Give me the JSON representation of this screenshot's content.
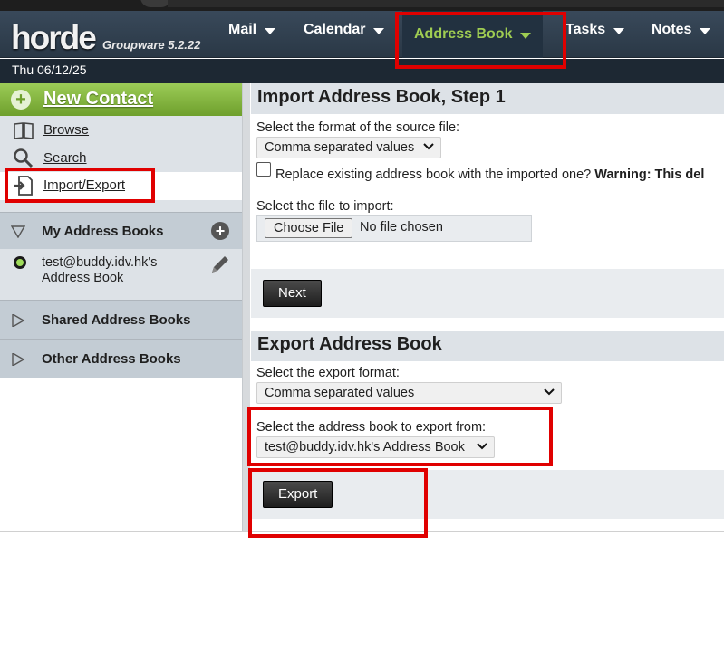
{
  "app": {
    "logo_text": "horde",
    "product": "Groupware 5.2.22",
    "date": "Thu 06/12/25"
  },
  "nav": {
    "mail": "Mail",
    "calendar": "Calendar",
    "address_book": "Address Book",
    "tasks": "Tasks",
    "notes": "Notes"
  },
  "sidebar": {
    "new_contact": "New Contact",
    "browse": "Browse",
    "search": "Search",
    "import_export": "Import/Export",
    "my_address_books": "My Address Books",
    "book_name_line1": "test@buddy.idv.hk's",
    "book_name_line2": "Address Book",
    "shared_address_books": "Shared Address Books",
    "other_address_books": "Other Address Books"
  },
  "import": {
    "title": "Import Address Book, Step 1",
    "format_label": "Select the format of the source file:",
    "format_value": "Comma separated values",
    "replace_label": "Replace existing address book with the imported one?",
    "warning_text": "Warning: This del",
    "file_label": "Select the file to import:",
    "choose_file": "Choose File",
    "no_file": "No file chosen",
    "next_button": "Next"
  },
  "export": {
    "title": "Export Address Book",
    "format_label": "Select the export format:",
    "format_value": "Comma separated values",
    "book_label": "Select the address book to export from:",
    "book_value": "test@buddy.idv.hk's Address Book",
    "export_button": "Export"
  },
  "colors": {
    "topbar": "#34434f",
    "accent_green": "#9fcd52",
    "annotation_red": "#e00000"
  },
  "icons": [
    "browse-icon",
    "search-icon",
    "import-export-icon",
    "add-icon",
    "pencil-icon",
    "triangle-icon",
    "chevron-down-icon"
  ]
}
